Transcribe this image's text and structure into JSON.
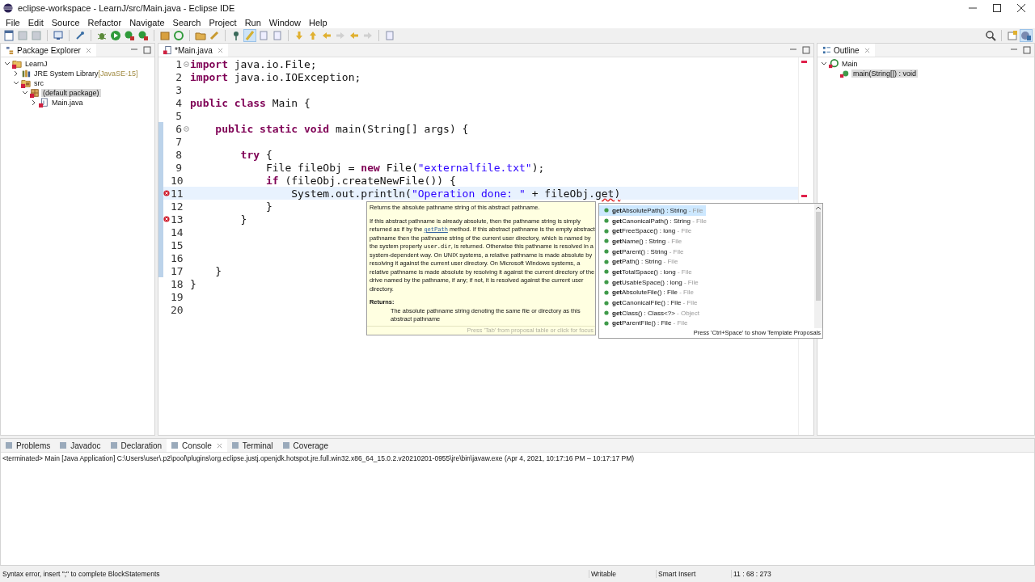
{
  "window": {
    "title": "eclipse-workspace - LearnJ/src/Main.java - Eclipse IDE"
  },
  "menu": [
    "File",
    "Edit",
    "Source",
    "Refactor",
    "Navigate",
    "Search",
    "Project",
    "Run",
    "Window",
    "Help"
  ],
  "package_explorer": {
    "title": "Package Explorer",
    "tree": [
      {
        "label": "LearnJ",
        "kind": "project",
        "error": true,
        "expanded": true,
        "selected": false,
        "children": [
          {
            "label": "JRE System Library",
            "suffix": "[JavaSE-15]",
            "kind": "library",
            "error": false,
            "expanded": false,
            "selected": false
          },
          {
            "label": "src",
            "kind": "folder",
            "error": true,
            "expanded": true,
            "selected": false,
            "children": [
              {
                "label": "(default package)",
                "kind": "package",
                "error": true,
                "expanded": true,
                "selected": true,
                "children": [
                  {
                    "label": "Main.java",
                    "kind": "file",
                    "error": true,
                    "expanded": false,
                    "selected": false
                  }
                ]
              }
            ]
          }
        ]
      }
    ]
  },
  "editor": {
    "tab": "*Main.java",
    "lines": [
      {
        "number": "1",
        "fold": true,
        "error": false,
        "current": false,
        "scope": false,
        "segments": [
          {
            "text": "import",
            "kind": "keyword"
          },
          {
            "text": " java.io.File;",
            "kind": "plain"
          }
        ]
      },
      {
        "number": "2",
        "fold": false,
        "error": false,
        "current": false,
        "scope": false,
        "segments": [
          {
            "text": "import",
            "kind": "keyword"
          },
          {
            "text": " java.io.IOException;",
            "kind": "plain"
          }
        ]
      },
      {
        "number": "3",
        "fold": false,
        "error": false,
        "current": false,
        "scope": false
      },
      {
        "number": "4",
        "fold": false,
        "error": false,
        "current": false,
        "scope": false,
        "segments": [
          {
            "text": "public class",
            "kind": "keyword"
          },
          {
            "text": " Main {",
            "kind": "plain"
          }
        ]
      },
      {
        "number": "5",
        "fold": false,
        "error": false,
        "current": false,
        "scope": false
      },
      {
        "number": "6",
        "fold": true,
        "error": false,
        "current": false,
        "scope": true,
        "segments": [
          {
            "text": "    public static void",
            "kind": "keyword"
          },
          {
            "text": " main(String[] args) {",
            "kind": "plain"
          }
        ]
      },
      {
        "number": "7",
        "fold": false,
        "error": false,
        "current": false,
        "scope": true
      },
      {
        "number": "8",
        "fold": false,
        "error": false,
        "current": false,
        "scope": true,
        "segments": [
          {
            "text": "        try",
            "kind": "keyword"
          },
          {
            "text": " {",
            "kind": "plain"
          }
        ]
      },
      {
        "number": "9",
        "fold": false,
        "error": false,
        "current": false,
        "scope": true,
        "segments": [
          {
            "text": "            File fileObj = ",
            "kind": "plain"
          },
          {
            "text": "new",
            "kind": "keyword"
          },
          {
            "text": " File(",
            "kind": "plain"
          },
          {
            "text": "\"externalfile.txt\"",
            "kind": "string"
          },
          {
            "text": ");",
            "kind": "plain"
          }
        ]
      },
      {
        "number": "10",
        "fold": false,
        "error": false,
        "current": false,
        "scope": true,
        "segments": [
          {
            "text": "            if",
            "kind": "keyword"
          },
          {
            "text": " (fileObj.createNewFile()) {",
            "kind": "plain"
          }
        ]
      },
      {
        "number": "11",
        "fold": false,
        "error": true,
        "current": true,
        "scope": true,
        "segments": [
          {
            "text": "                System.out.println(",
            "kind": "plain"
          },
          {
            "text": "\"Operation done: \"",
            "kind": "string"
          },
          {
            "text": " + fileObj.",
            "kind": "plain"
          },
          {
            "text": "get)",
            "kind": "error"
          }
        ]
      },
      {
        "number": "12",
        "fold": false,
        "error": false,
        "current": false,
        "scope": true,
        "segments": [
          {
            "text": "            }",
            "kind": "plain"
          }
        ]
      },
      {
        "number": "13",
        "fold": false,
        "error": true,
        "current": false,
        "scope": true,
        "segments": [
          {
            "text": "        }",
            "kind": "plain"
          }
        ]
      },
      {
        "number": "14",
        "fold": false,
        "error": false,
        "current": false,
        "scope": true
      },
      {
        "number": "15",
        "fold": false,
        "error": false,
        "current": false,
        "scope": true
      },
      {
        "number": "16",
        "fold": false,
        "error": false,
        "current": false,
        "scope": true
      },
      {
        "number": "17",
        "fold": false,
        "error": false,
        "current": false,
        "scope": true,
        "segments": [
          {
            "text": "    }",
            "kind": "plain"
          }
        ]
      },
      {
        "number": "18",
        "fold": false,
        "error": false,
        "current": false,
        "scope": false,
        "segments": [
          {
            "text": "}",
            "kind": "plain"
          }
        ]
      },
      {
        "number": "19",
        "fold": false,
        "error": false,
        "current": false,
        "scope": false
      },
      {
        "number": "20",
        "fold": false,
        "error": false,
        "current": false,
        "scope": false
      }
    ],
    "javadoc": {
      "summary": "Returns the absolute pathname string of this abstract pathname.",
      "body": [
        {
          "text": "If this abstract pathname is already absolute, then the pathname string is simply returned as if by the ",
          "kind": "text"
        },
        {
          "text": "getPath",
          "kind": "link"
        },
        {
          "text": " method. If this abstract pathname is the empty abstract pathname then the pathname string of the current user directory, which is named by the system property ",
          "kind": "text"
        },
        {
          "text": "user.dir",
          "kind": "code"
        },
        {
          "text": ", is returned. Otherwise this pathname is resolved in a system-dependent way. On UNIX systems, a relative pathname is made absolute by resolving it against the current user directory. On Microsoft Windows systems, a relative pathname is made absolute by resolving it against the current directory of the drive named by the pathname, if any; if not, it is resolved against the current user directory.",
          "kind": "text"
        }
      ],
      "returns_heading": "Returns:",
      "returns": "The absolute pathname string denoting the same file or directory as this abstract pathname",
      "footer": "Press 'Tab' from proposal table or click for focus"
    },
    "proposals": {
      "items": [
        {
          "name": "**get**AbsolutePath() : String",
          "owner": "- File",
          "selected": true
        },
        {
          "name": "**get**CanonicalPath() : String",
          "owner": "- File",
          "selected": false
        },
        {
          "name": "**get**FreeSpace() : long",
          "owner": "- File",
          "selected": false
        },
        {
          "name": "**get**Name() : String",
          "owner": "- File",
          "selected": false
        },
        {
          "name": "**get**Parent() : String",
          "owner": "- File",
          "selected": false
        },
        {
          "name": "**get**Path() : String",
          "owner": "- File",
          "selected": false
        },
        {
          "name": "**get**TotalSpace() : long",
          "owner": "- File",
          "selected": false
        },
        {
          "name": "**get**UsableSpace() : long",
          "owner": "- File",
          "selected": false
        },
        {
          "name": "**get**AbsoluteFile() : File",
          "owner": "- File",
          "selected": false
        },
        {
          "name": "**get**CanonicalFile() : File",
          "owner": "- File",
          "selected": false
        },
        {
          "name": "**get**Class() : Class<?>",
          "owner": "- Object",
          "selected": false
        },
        {
          "name": "**get**ParentFile() : File",
          "owner": "- File",
          "selected": false
        }
      ],
      "hint": "Press 'Ctrl+Space' to show Template Proposals"
    }
  },
  "outline": {
    "title": "Outline",
    "tree": [
      {
        "label": "Main",
        "kind": "class",
        "expanded": true,
        "selected": false,
        "children": [
          {
            "label": "main(String[]) : void",
            "kind": "method",
            "selected": true
          }
        ]
      }
    ]
  },
  "bottom_tabs": [
    {
      "label": "Problems",
      "selected": false
    },
    {
      "label": "Javadoc",
      "selected": false
    },
    {
      "label": "Declaration",
      "selected": false
    },
    {
      "label": "Console",
      "selected": true
    },
    {
      "label": "Terminal",
      "selected": false
    },
    {
      "label": "Coverage",
      "selected": false
    }
  ],
  "console": {
    "header": "<terminated> Main [Java Application] C:\\Users\\user\\.p2\\pool\\plugins\\org.eclipse.justj.openjdk.hotspot.jre.full.win32.x86_64_15.0.2.v20210201-0955\\jre\\bin\\javaw.exe  (Apr 4, 2021, 10:17:16 PM – 10:17:17 PM)"
  },
  "status_bar": {
    "message": "Syntax error, insert \";\" to complete BlockStatements",
    "writable": "Writable",
    "insert_mode": "Smart Insert",
    "position": "11 : 68 : 273"
  }
}
